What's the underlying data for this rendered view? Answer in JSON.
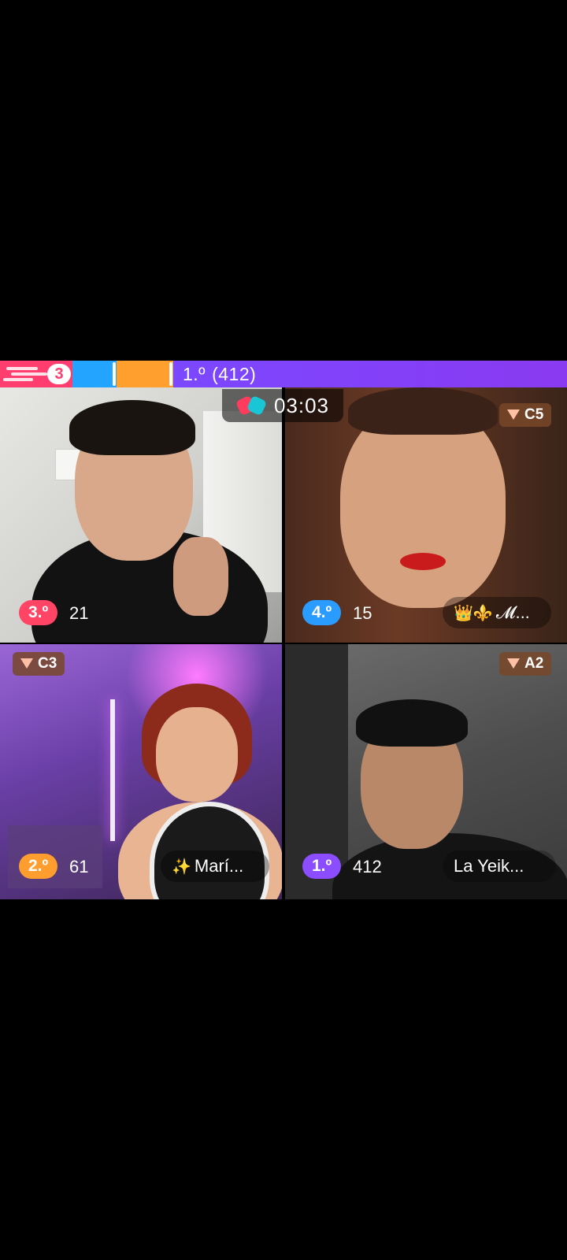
{
  "progress": {
    "bubble_text": "3",
    "rank_label": "1.º",
    "rank_score": "(412)",
    "colors": {
      "red": "#ff3d6e",
      "blue": "#22a4ff",
      "orange": "#ffa02e",
      "purple": "#7b48ff"
    }
  },
  "timer": {
    "icon": "boxing-gloves-icon",
    "text": "03:03"
  },
  "tiles": [
    {
      "rank": "3.º",
      "score": "21",
      "rank_color": "#ff4466"
    },
    {
      "rank": "4.º",
      "score": "15",
      "level": "C5",
      "name": "𝓜...",
      "name_deco": "👑⚜️",
      "rank_color": "#2b9cff"
    },
    {
      "rank": "2.º",
      "score": "61",
      "level": "C3",
      "name": "Marí...",
      "name_deco": "✨",
      "rank_color": "#ff9d2e"
    },
    {
      "rank": "1.º",
      "score": "412",
      "level": "A2",
      "name": "La Yeik...",
      "rank_color": "#8b4dff"
    }
  ]
}
